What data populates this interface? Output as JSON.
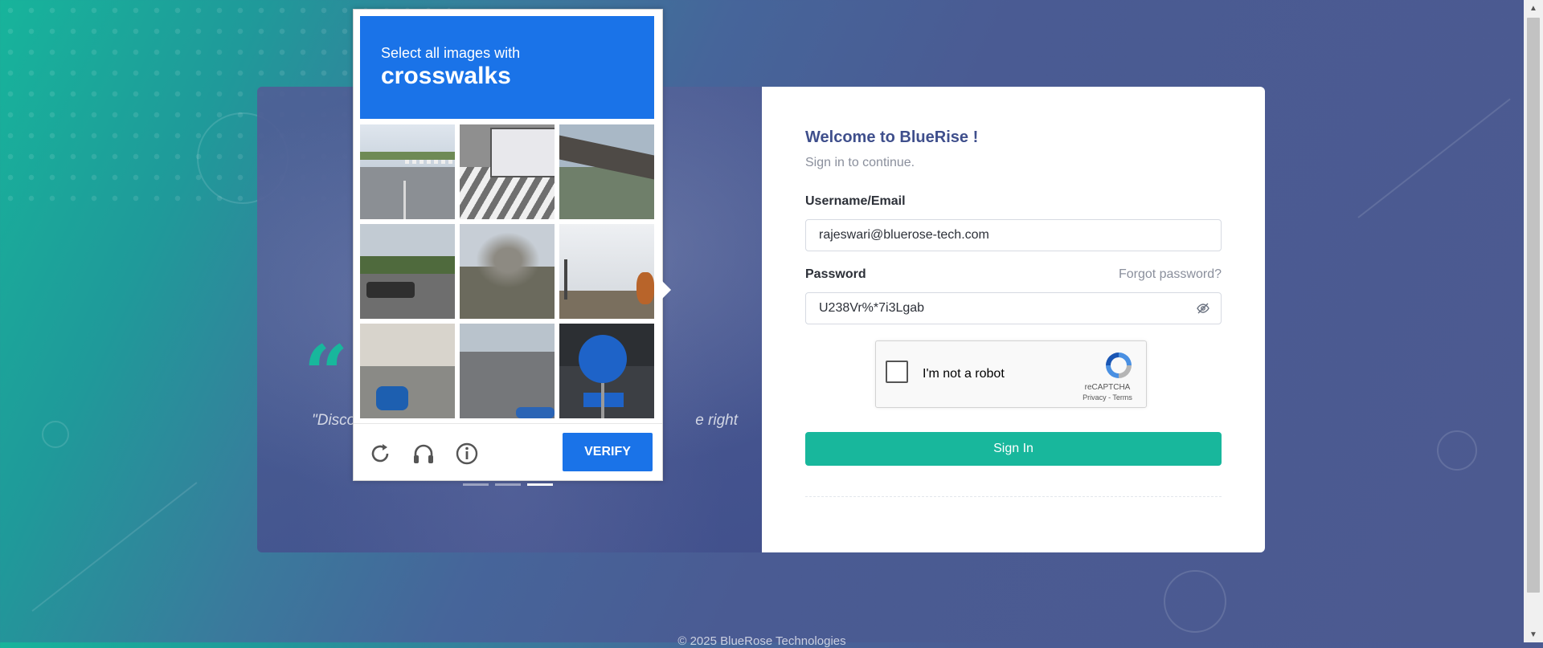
{
  "captcha": {
    "instruction": "Select all images with",
    "target": "crosswalks",
    "verify_label": "VERIFY",
    "tiles": [
      {
        "label": "road with crosswalk"
      },
      {
        "label": "crosswalk with bus"
      },
      {
        "label": "building roof"
      },
      {
        "label": "traffic lights and car"
      },
      {
        "label": "bare trees"
      },
      {
        "label": "traffic lights and sky"
      },
      {
        "label": "street corner"
      },
      {
        "label": "road"
      },
      {
        "label": "bicycle sign"
      }
    ]
  },
  "quote": {
    "mark": "“",
    "text_start": "\"Disco",
    "text_end": "e right"
  },
  "login": {
    "welcome": "Welcome to BlueRise !",
    "subtitle": "Sign in to continue.",
    "username_label": "Username/Email",
    "username_value": "rajeswari@bluerose-tech.com",
    "password_label": "Password",
    "forgot_label": "Forgot password?",
    "password_value": "U238Vr%*7i3Lgab",
    "recaptcha_label": "I'm not a robot",
    "recaptcha_brand": "reCAPTCHA",
    "recaptcha_links": "Privacy - Terms",
    "signin_label": "Sign In"
  },
  "footer": {
    "text": "© 2025 BlueRose Technologies"
  },
  "colors": {
    "accent": "#18b79c",
    "captcha_blue": "#1a73e8",
    "heading": "#3f4f8c"
  }
}
